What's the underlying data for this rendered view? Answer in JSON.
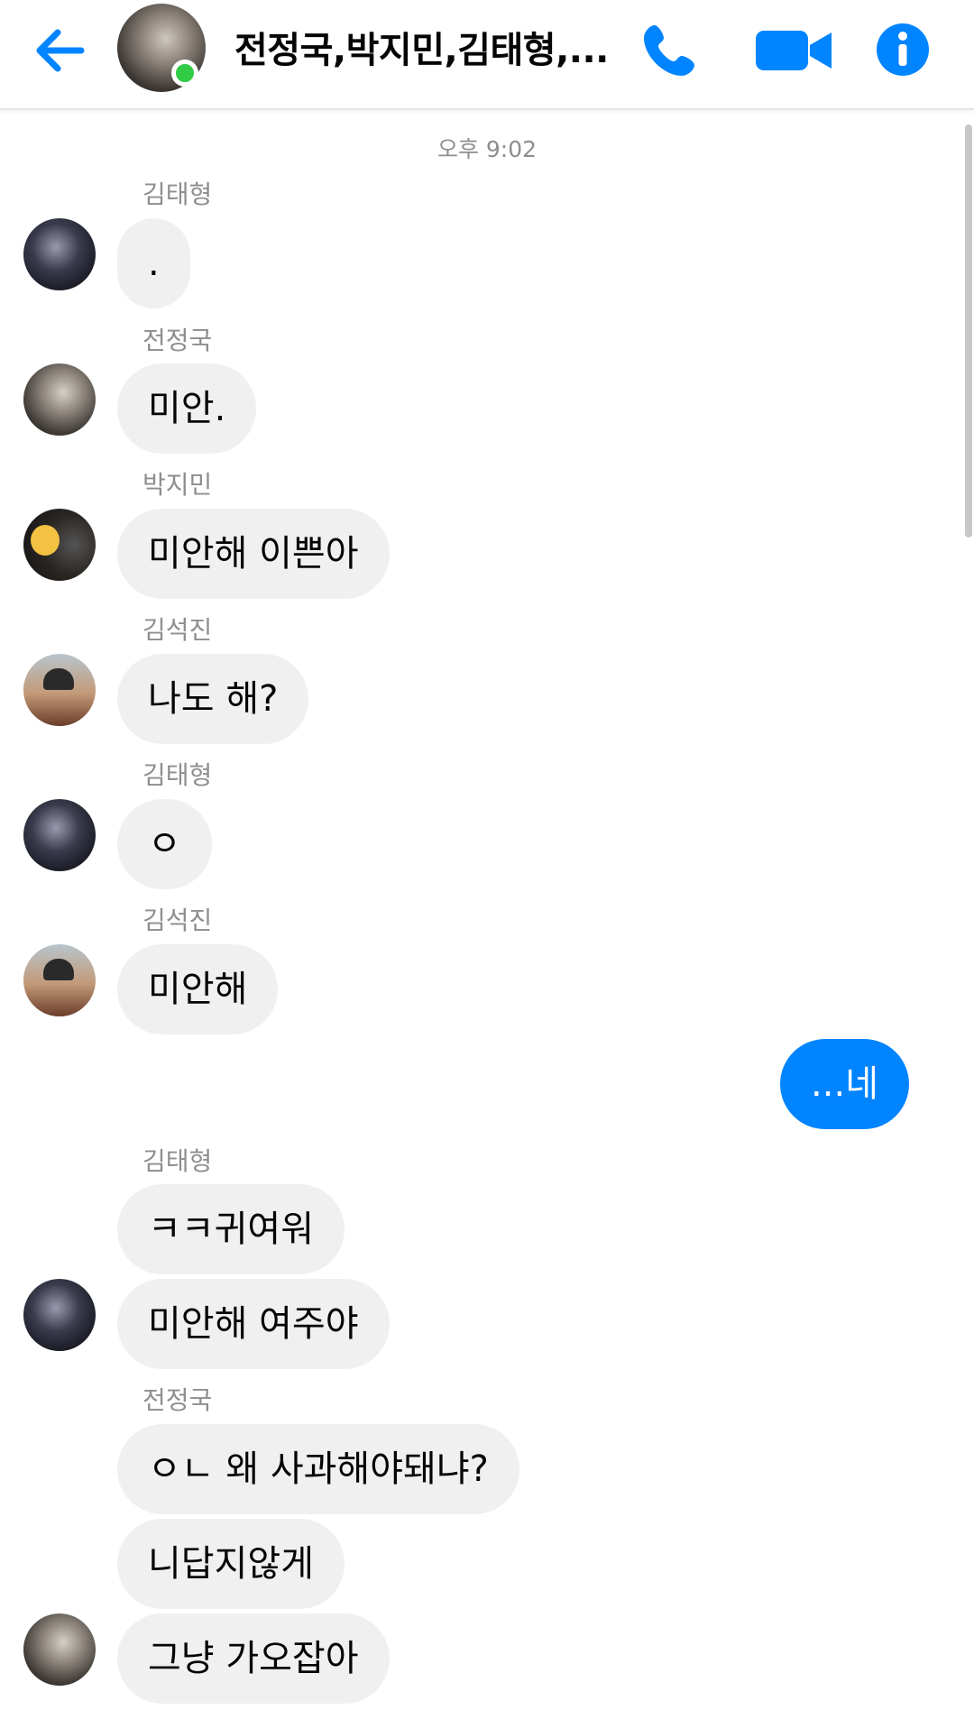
{
  "header": {
    "title": "전정국,박지민,김태형,...",
    "accent_color": "#0084ff",
    "online_color": "#31cc46",
    "icons": {
      "back": "back-arrow-icon",
      "call": "phone-icon",
      "video": "video-camera-icon",
      "info": "info-icon"
    }
  },
  "conversation": {
    "timestamp": "오후 9:02",
    "messages": [
      {
        "sender": "김태형",
        "text": "."
      },
      {
        "sender": "전정국",
        "text": "미안."
      },
      {
        "sender": "박지민",
        "text": "미안해 이쁜아"
      },
      {
        "sender": "김석진",
        "text": "나도 해?"
      },
      {
        "sender": "김태형",
        "text": "ㅇ"
      },
      {
        "sender": "김석진",
        "text": "미안해"
      },
      {
        "sender": "me",
        "text": "...네"
      },
      {
        "sender": "김태형",
        "text": "ㅋㅋ귀여워"
      },
      {
        "sender": "김태형",
        "text": "미안해 여주야"
      },
      {
        "sender": "전정국",
        "text": "ㅇㄴ 왜 사과해야돼냐?"
      },
      {
        "sender": "전정국",
        "text": "니답지않게"
      },
      {
        "sender": "전정국",
        "text": "그냥 가오잡아"
      }
    ]
  }
}
